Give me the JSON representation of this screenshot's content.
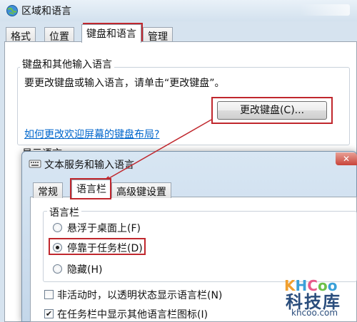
{
  "window": {
    "title": "区域和语言",
    "tabs": [
      {
        "label": "格式"
      },
      {
        "label": "位置"
      },
      {
        "label": "键盘和语言"
      },
      {
        "label": "管理"
      }
    ],
    "keyboard_group": {
      "legend": "键盘和其他输入语言",
      "description": "要更改键盘或输入语言，请单击“更改键盘”。",
      "change_button": "更改键盘(C)...",
      "welcome_link": "如何更改欢迎屏幕的键盘布局?"
    },
    "display_group_legend": "显示语言"
  },
  "dialog": {
    "title": "文本服务和输入语言",
    "close_glyph": "✕",
    "tabs": [
      {
        "label": "常规"
      },
      {
        "label": "语言栏"
      },
      {
        "label": "高级键设置"
      }
    ],
    "langbar_group": {
      "legend": "语言栏",
      "options": [
        {
          "label": "悬浮于桌面上(F)",
          "checked": false
        },
        {
          "label": "停靠于任务栏(D)",
          "checked": true
        },
        {
          "label": "隐藏(H)",
          "checked": false
        }
      ]
    },
    "checkboxes": [
      {
        "label": "非活动时，以透明状态显示语言栏(N)",
        "checked": false
      },
      {
        "label": "在任务栏中显示其他语言栏图标(I)",
        "checked": true
      }
    ]
  },
  "watermark": {
    "logo": "KHCoo",
    "text": "科技库",
    "sub": "khcoo.com"
  },
  "colors": {
    "highlight": "#c0272d",
    "link": "#0066cc",
    "watermark": "#2a4d7c"
  }
}
